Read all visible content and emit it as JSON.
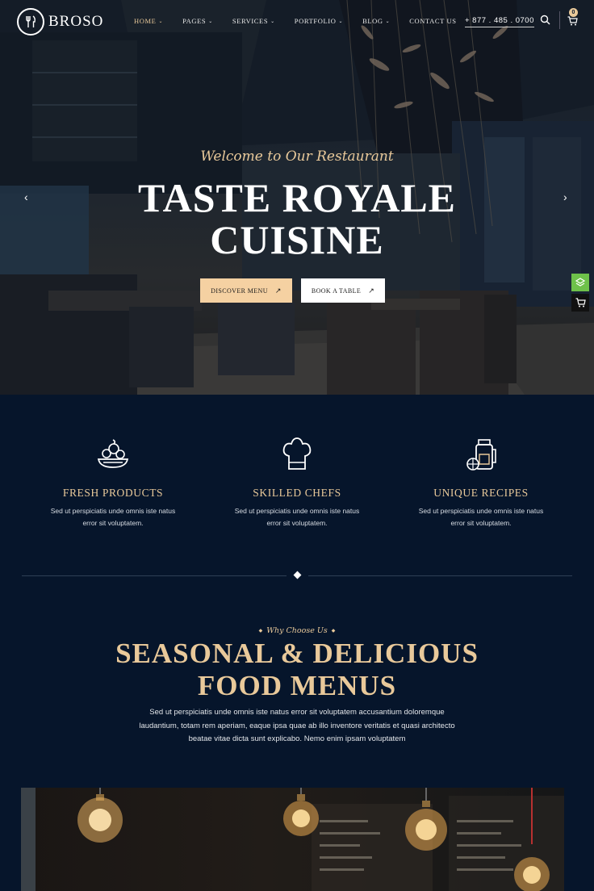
{
  "brand": {
    "name": "BROSO",
    "logo_icon": "fork-knife-circle-logo"
  },
  "nav": {
    "items": [
      {
        "label": "HOME",
        "active": true,
        "has_dropdown": true
      },
      {
        "label": "PAGES",
        "has_dropdown": true
      },
      {
        "label": "SERVICES",
        "has_dropdown": true
      },
      {
        "label": "PORTFOLIO",
        "has_dropdown": true
      },
      {
        "label": "BLOG",
        "has_dropdown": true
      },
      {
        "label": "CONTACT US",
        "has_dropdown": false
      }
    ],
    "phone": "+ 877 . 485 . 0700",
    "cart_count": "0"
  },
  "hero": {
    "subtitle": "Welcome to Our Restaurant",
    "title_line1": "TASTE ROYALE",
    "title_line2": "CUISINE",
    "btn_discover": "DISCOVER MENU",
    "btn_book": "BOOK A TABLE",
    "arrow_icon": "↗",
    "prev_arrow": "‹",
    "next_arrow": "›"
  },
  "features": [
    {
      "icon": "food-bowl-icon",
      "title": "FRESH PRODUCTS",
      "line1": "Sed ut perspiciatis unde omnis iste natus",
      "line2": "error sit voluptatem."
    },
    {
      "icon": "chef-hat-icon",
      "title": "SKILLED CHEFS",
      "line1": "Sed ut perspiciatis unde omnis iste natus",
      "line2": "error sit voluptatem."
    },
    {
      "icon": "drink-jar-icon",
      "title": "UNIQUE RECIPES",
      "line1": "Sed ut perspiciatis unde omnis iste natus",
      "line2": "error sit voluptatem."
    }
  ],
  "why": {
    "tag": "Why Choose Us",
    "title_line1": "SEASONAL & DELICIOUS",
    "title_line2": "FOOD MENUS",
    "text_line1": "Sed ut perspiciatis unde omnis iste natus error sit voluptatem accusantium doloremque",
    "text_line2": "laudantium, totam rem aperiam, eaque ipsa quae ab illo inventore veritatis et quasi architecto",
    "text_line3": "beatae vitae dicta sunt explicabo. Nemo enim ipsam voluptatem"
  },
  "colors": {
    "accent": "#e9c99a",
    "background": "#06152b",
    "button_primary": "#f5d1a2",
    "side_green": "#6ec14a"
  }
}
